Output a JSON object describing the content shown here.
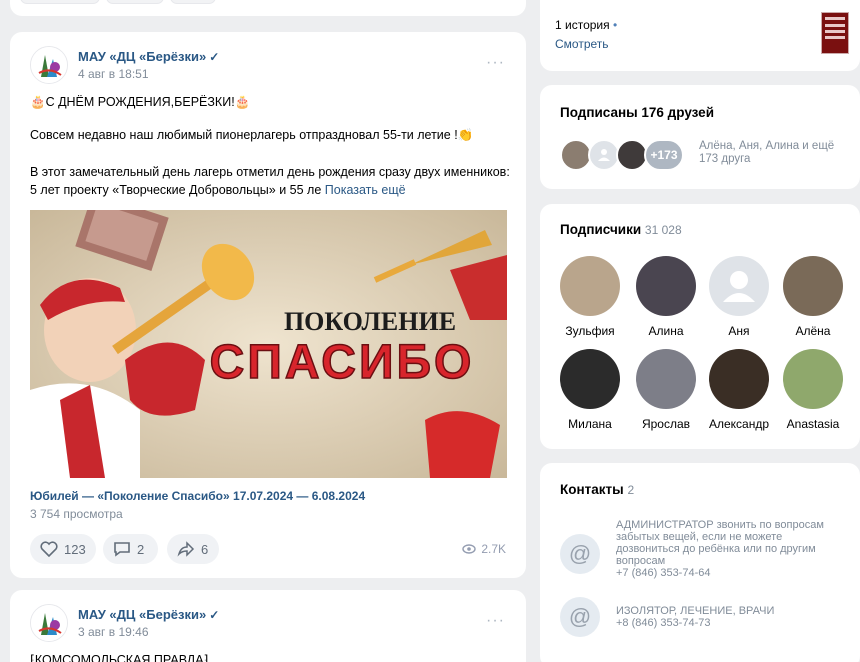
{
  "post1": {
    "author": "МАУ «ДЦ «Берёзки»",
    "verified_mark": "✓",
    "date": "4 авг в 18:51",
    "menu_dots": "···",
    "headline": "🎂С ДНЁМ РОЖДЕНИЯ,БЕРЁЗКИ!🎂",
    "line1": "Совсем недавно наш любимый пионерлагерь отпраздновал 55-ти летие !👏",
    "line2": "В этот замечательный день лагерь отметил день рождения сразу двух именников:",
    "line3": "5 лет проекту «Творческие Добровольцы» и 55 ле",
    "show_more": "Показать ещё",
    "banner_top": "ПОКОЛЕНИЕ",
    "banner_main": "СПАСИБО",
    "video_title": "Юбилей — «Поколение Спасибо» 17.07.2024 — 6.08.2024",
    "views": "3 754 просмотра",
    "likes": "123",
    "comments": "2",
    "shares": "6",
    "view_count": "2.7K"
  },
  "post2": {
    "author": "МАУ «ДЦ «Берёзки»",
    "verified_mark": "✓",
    "date": "3 авг в 19:46",
    "menu_dots": "···",
    "headline": "⁅КОМСОМОЛЬСКАЯ ПРАВДА⁆"
  },
  "stories": {
    "count": "1 история",
    "dot": "•",
    "watch": "Смотреть"
  },
  "friends": {
    "title": "Подписаны 176 друзей",
    "extra": "+173",
    "names": "Алёна, Аня, Алина и ещё",
    "names2": "173 друга"
  },
  "subscribers": {
    "title": "Подписчики",
    "count": "31 028",
    "people": [
      {
        "name": "Зульфия",
        "color": "#b9a58c"
      },
      {
        "name": "Алина",
        "color": "#4a4550"
      },
      {
        "name": "Аня",
        "color": "#dfe3e8"
      },
      {
        "name": "Алёна",
        "color": "#7a6a58"
      },
      {
        "name": "Милана",
        "color": "#2b2b2b"
      },
      {
        "name": "Ярослав",
        "color": "#7d7e88"
      },
      {
        "name": "Александр",
        "color": "#3a2e25"
      },
      {
        "name": "Anastasia",
        "color": "#8fa86c"
      }
    ]
  },
  "contacts": {
    "title": "Контакты",
    "count": "2",
    "c1_role": "АДМИНИСТРАТОР звонить по вопросам забытых вещей, если не можете дозвониться до ребёнка или по другим вопросам",
    "c1_phone": "+7 (846) 353-74-64",
    "c2_role": "ИЗОЛЯТОР, ЛЕЧЕНИЕ, ВРАЧИ",
    "c2_phone": "+8 (846) 353-74-73"
  }
}
